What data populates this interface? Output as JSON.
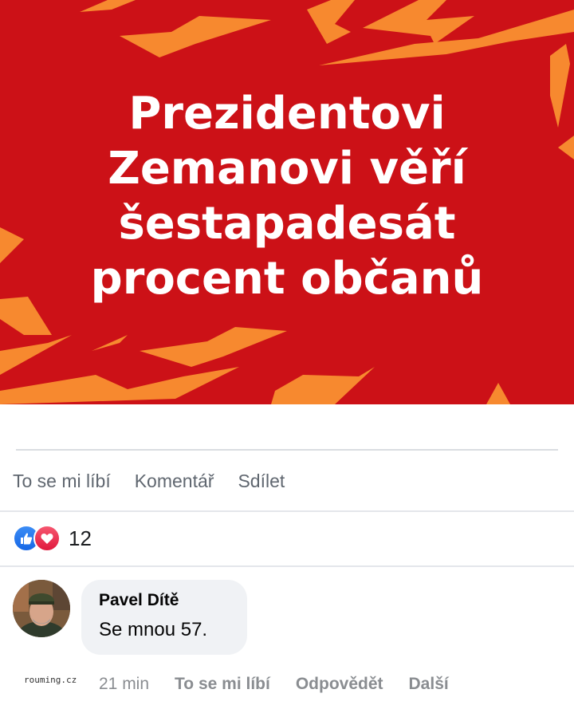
{
  "banner": {
    "background_color": "#cc1117",
    "bolt_color": "#f7892f",
    "headline_lines": [
      "Prezidentovi",
      "Zemanovi věří",
      "šestapadesát",
      "procent občanů"
    ]
  },
  "actions": {
    "like_label": "To se mi líbí",
    "comment_label": "Komentář",
    "share_label": "Sdílet"
  },
  "reactions": {
    "icons": [
      "like-icon",
      "love-icon"
    ],
    "count": "12"
  },
  "comment": {
    "author": "Pavel Dítě",
    "text": "Se mnou 57.",
    "time": "21 min",
    "like_label": "To se mi líbí",
    "reply_label": "Odpovědět",
    "more_label": "Další"
  },
  "watermark": "rouming.cz"
}
